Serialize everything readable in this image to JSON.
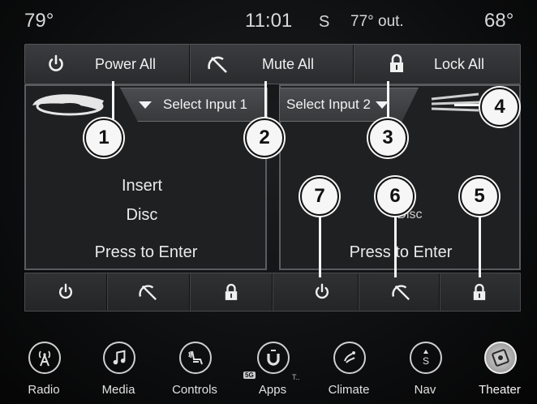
{
  "status": {
    "left_temp": "79°",
    "time": "11:01",
    "compass": "S",
    "outside": "77° out.",
    "right_temp": "68°"
  },
  "global_bar": {
    "power": "Power All",
    "mute": "Mute All",
    "lock": "Lock All"
  },
  "screen_left": {
    "select": "Select Input 1",
    "line1": "Insert",
    "line2": "Disc",
    "enter": "Press to Enter"
  },
  "screen_right": {
    "select": "Select Input 2",
    "line2": "Disc",
    "enter": "Press to Enter"
  },
  "callouts": [
    "1",
    "2",
    "3",
    "4",
    "5",
    "6",
    "7"
  ],
  "nav": {
    "items": [
      "Radio",
      "Media",
      "Controls",
      "Apps",
      "Climate",
      "Nav",
      "Theater"
    ],
    "apps_badge": "5G",
    "apps_ellipsis": "T..",
    "active": "Theater"
  },
  "icons": [
    "power-icon",
    "mute-icon",
    "lock-icon",
    "bluray-disc-icon",
    "radio-icon",
    "music-note-icon",
    "controls-seat-icon",
    "apps-u-icon",
    "climate-icon",
    "compass-s-icon",
    "film-reel-icon"
  ]
}
